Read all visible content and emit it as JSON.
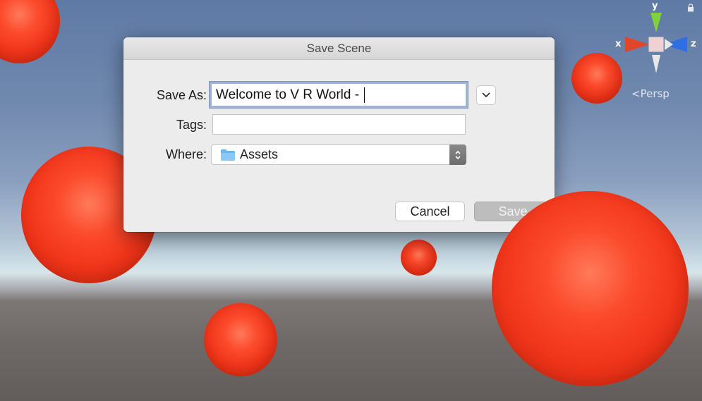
{
  "dialog": {
    "title": "Save Scene",
    "save_as": {
      "label": "Save As:",
      "value": "Welcome to V R World - "
    },
    "tags": {
      "label": "Tags:",
      "value": ""
    },
    "where": {
      "label": "Where:",
      "selected": "Assets"
    },
    "cancel_label": "Cancel",
    "save_label": "Save"
  },
  "scene_gizmo": {
    "axes": {
      "y": "y",
      "x": "x",
      "z": "z"
    },
    "projection_label": "Persp",
    "icons": [
      "lock-icon",
      "scene-orientation-gizmo"
    ]
  },
  "colors": {
    "sphere": "#f0351b",
    "dialog_bg": "#ececec",
    "focus_ring": "#9fb3d1",
    "y_axis": "#7fd23a",
    "x_axis": "#e0462a",
    "z_axis": "#2f6fe0"
  }
}
